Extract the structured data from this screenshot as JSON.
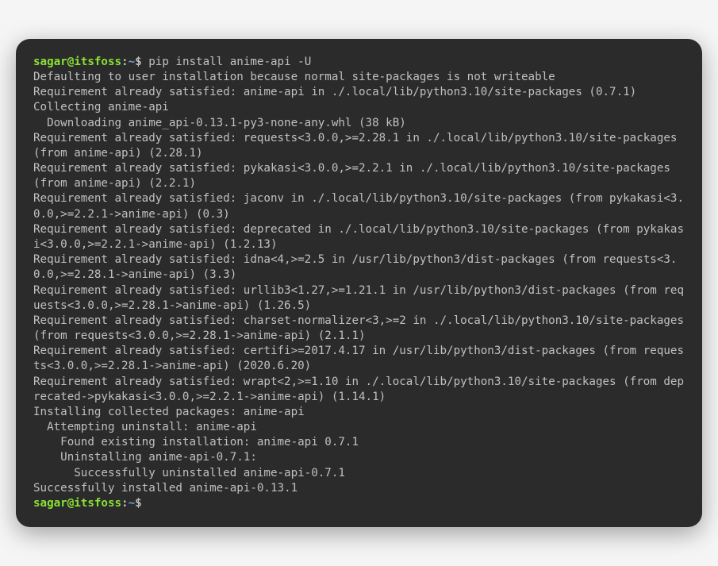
{
  "prompt": {
    "user": "sagar@itsfoss",
    "separator": ":",
    "path": "~",
    "symbol": "$"
  },
  "command1": "pip install anime-api -U",
  "output": {
    "line1": "Defaulting to user installation because normal site-packages is not writeable",
    "line2": "Requirement already satisfied: anime-api in ./.local/lib/python3.10/site-packages (0.7.1)",
    "line3": "Collecting anime-api",
    "line4": "  Downloading anime_api-0.13.1-py3-none-any.whl (38 kB)",
    "line5": "Requirement already satisfied: requests<3.0.0,>=2.28.1 in ./.local/lib/python3.10/site-packages (from anime-api) (2.28.1)",
    "line6": "Requirement already satisfied: pykakasi<3.0.0,>=2.2.1 in ./.local/lib/python3.10/site-packages (from anime-api) (2.2.1)",
    "line7": "Requirement already satisfied: jaconv in ./.local/lib/python3.10/site-packages (from pykakasi<3.0.0,>=2.2.1->anime-api) (0.3)",
    "line8": "Requirement already satisfied: deprecated in ./.local/lib/python3.10/site-packages (from pykakasi<3.0.0,>=2.2.1->anime-api) (1.2.13)",
    "line9": "Requirement already satisfied: idna<4,>=2.5 in /usr/lib/python3/dist-packages (from requests<3.0.0,>=2.28.1->anime-api) (3.3)",
    "line10": "Requirement already satisfied: urllib3<1.27,>=1.21.1 in /usr/lib/python3/dist-packages (from requests<3.0.0,>=2.28.1->anime-api) (1.26.5)",
    "line11": "Requirement already satisfied: charset-normalizer<3,>=2 in ./.local/lib/python3.10/site-packages (from requests<3.0.0,>=2.28.1->anime-api) (2.1.1)",
    "line12": "Requirement already satisfied: certifi>=2017.4.17 in /usr/lib/python3/dist-packages (from requests<3.0.0,>=2.28.1->anime-api) (2020.6.20)",
    "line13": "Requirement already satisfied: wrapt<2,>=1.10 in ./.local/lib/python3.10/site-packages (from deprecated->pykakasi<3.0.0,>=2.2.1->anime-api) (1.14.1)",
    "line14": "Installing collected packages: anime-api",
    "line15": "  Attempting uninstall: anime-api",
    "line16": "    Found existing installation: anime-api 0.7.1",
    "line17": "    Uninstalling anime-api-0.7.1:",
    "line18": "      Successfully uninstalled anime-api-0.7.1",
    "line19": "Successfully installed anime-api-0.13.1"
  },
  "command2": ""
}
